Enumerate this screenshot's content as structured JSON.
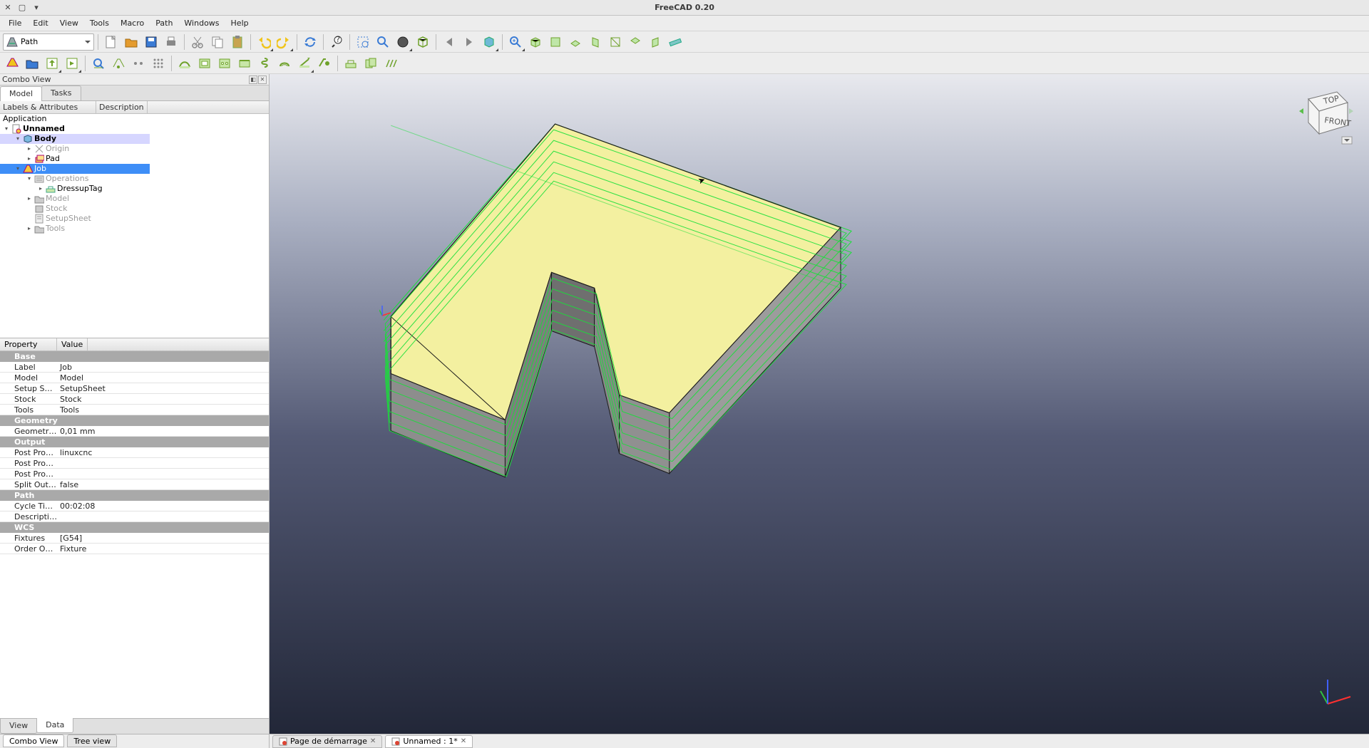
{
  "window": {
    "title": "FreeCAD 0.20"
  },
  "menubar": [
    "File",
    "Edit",
    "View",
    "Tools",
    "Macro",
    "Path",
    "Windows",
    "Help"
  ],
  "workbench": {
    "selected": "Path"
  },
  "combo": {
    "title": "Combo View",
    "tabs": [
      "Model",
      "Tasks"
    ],
    "active_tab": 0,
    "tree_headers": [
      "Labels & Attributes",
      "Description"
    ],
    "property_headers": [
      "Property",
      "Value"
    ],
    "bottom_tabs": [
      "View",
      "Data"
    ],
    "bottom_active_tab": 1,
    "footer_tabs": [
      "Combo View",
      "Tree view"
    ],
    "footer_active_tab": 0
  },
  "tree": {
    "root": "Application",
    "items": [
      {
        "indent": 0,
        "label": "Unnamed",
        "exp": "▾",
        "bold": true,
        "dim": false,
        "icon": "doc",
        "sel": ""
      },
      {
        "indent": 1,
        "label": "Body",
        "exp": "▾",
        "bold": true,
        "dim": false,
        "icon": "body",
        "sel": "light"
      },
      {
        "indent": 2,
        "label": "Origin",
        "exp": "▸",
        "bold": false,
        "dim": true,
        "icon": "origin",
        "sel": ""
      },
      {
        "indent": 2,
        "label": "Pad",
        "exp": "▸",
        "bold": false,
        "dim": false,
        "icon": "pad",
        "sel": ""
      },
      {
        "indent": 1,
        "label": "Job",
        "exp": "▾",
        "bold": false,
        "dim": false,
        "icon": "job",
        "sel": "full"
      },
      {
        "indent": 2,
        "label": "Operations",
        "exp": "▾",
        "bold": false,
        "dim": true,
        "icon": "ops",
        "sel": ""
      },
      {
        "indent": 3,
        "label": "DressupTag",
        "exp": "▸",
        "bold": false,
        "dim": false,
        "icon": "dressup",
        "sel": ""
      },
      {
        "indent": 2,
        "label": "Model",
        "exp": "▸",
        "bold": false,
        "dim": true,
        "icon": "folder",
        "sel": ""
      },
      {
        "indent": 2,
        "label": "Stock",
        "exp": "",
        "bold": false,
        "dim": true,
        "icon": "stock",
        "sel": ""
      },
      {
        "indent": 2,
        "label": "SetupSheet",
        "exp": "",
        "bold": false,
        "dim": true,
        "icon": "sheet",
        "sel": ""
      },
      {
        "indent": 2,
        "label": "Tools",
        "exp": "▸",
        "bold": false,
        "dim": true,
        "icon": "folder",
        "sel": ""
      }
    ]
  },
  "properties": [
    {
      "type": "group",
      "label": "Base"
    },
    {
      "type": "row",
      "name": "Label",
      "value": "Job"
    },
    {
      "type": "row",
      "name": "Model",
      "value": "Model"
    },
    {
      "type": "row",
      "name": "Setup Sheet",
      "value": "SetupSheet"
    },
    {
      "type": "row",
      "name": "Stock",
      "value": "Stock"
    },
    {
      "type": "row",
      "name": "Tools",
      "value": "Tools"
    },
    {
      "type": "group",
      "label": "Geometry"
    },
    {
      "type": "row",
      "name": "Geometry T…",
      "value": "0,01 mm"
    },
    {
      "type": "group",
      "label": "Output"
    },
    {
      "type": "row",
      "name": "Post Proce…",
      "value": "linuxcnc"
    },
    {
      "type": "row",
      "name": "Post Proce…",
      "value": ""
    },
    {
      "type": "row",
      "name": "Post Proce…",
      "value": ""
    },
    {
      "type": "row",
      "name": "Split Output",
      "value": "false"
    },
    {
      "type": "group",
      "label": "Path"
    },
    {
      "type": "row",
      "name": "Cycle Time",
      "value": "00:02:08"
    },
    {
      "type": "row",
      "name": "Description",
      "value": ""
    },
    {
      "type": "group",
      "label": "WCS"
    },
    {
      "type": "row",
      "name": "Fixtures",
      "value": "[G54]"
    },
    {
      "type": "row",
      "name": "Order Outp…",
      "value": "Fixture"
    }
  ],
  "doctabs": [
    {
      "label": "Page de démarrage",
      "active": false
    },
    {
      "label": "Unnamed : 1*",
      "active": true
    }
  ],
  "navcube": {
    "top": "TOP",
    "front": "FRONT"
  },
  "toolbar1_icons": [
    "new",
    "open",
    "save",
    "print",
    "|",
    "cut",
    "copy",
    "paste",
    "|",
    "undo",
    "-",
    "redo",
    "|",
    "refresh",
    "|",
    "whatsthis",
    "|",
    "box-zoom",
    "zoom",
    "draw-style",
    "bbox",
    "|",
    "back",
    "forward",
    "link-nav",
    "|",
    "zoom-in",
    "iso",
    "front",
    "top",
    "right",
    "rear",
    "bottom",
    "left",
    "measure"
  ],
  "toolbar2_icons": [
    "job",
    "open-job",
    "export",
    "post",
    "|",
    "inspect",
    "sim",
    "dots1",
    "dots-grid",
    "|",
    "profile",
    "pocket",
    "drill",
    "face",
    "helix",
    "adaptive",
    "engrave",
    "deburr",
    "|",
    "dressup",
    "copy-op",
    "array"
  ]
}
